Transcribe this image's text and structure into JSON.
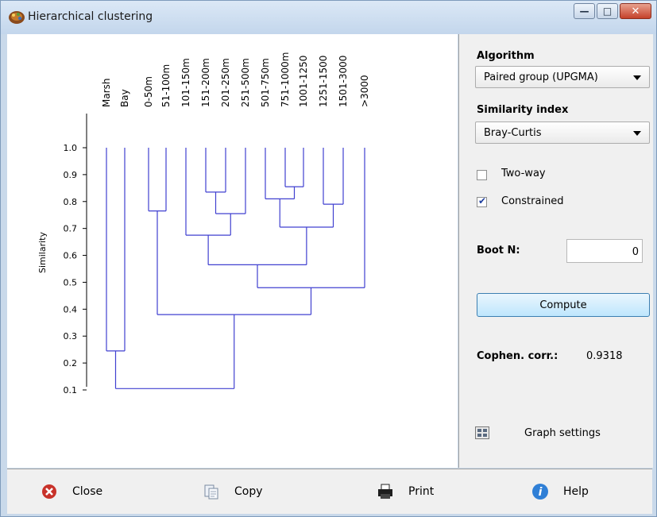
{
  "window": {
    "title": "Hierarchical clustering"
  },
  "plot": {
    "y_axis_label": "Similarity",
    "y_ticks": [
      "1.0",
      "0.9",
      "0.8",
      "0.7",
      "0.6",
      "0.5",
      "0.4",
      "0.3",
      "0.2",
      "0.1"
    ],
    "leaves": [
      "Marsh",
      "Bay",
      "0-50m",
      "51-100m",
      "101-150m",
      "151-200m",
      "201-250m",
      "251-500m",
      "501-750m",
      "751-1000m",
      "1001-1250",
      "1251-1500",
      "1501-3000",
      ">3000"
    ],
    "line_color": "#4040d0"
  },
  "side": {
    "algorithm_label": "Algorithm",
    "algorithm_value": "Paired group (UPGMA)",
    "similarity_label": "Similarity index",
    "similarity_value": "Bray-Curtis",
    "two_way_label": "Two-way",
    "two_way_checked": false,
    "constrained_label": "Constrained",
    "constrained_checked": true,
    "boot_label": "Boot N:",
    "boot_value": "0",
    "compute_label": "Compute",
    "coph_label": "Cophen. corr.:",
    "coph_value": "0.9318",
    "graph_settings_label": "Graph settings"
  },
  "footer": {
    "close_label": "Close",
    "copy_label": "Copy",
    "print_label": "Print",
    "help_label": "Help"
  }
}
